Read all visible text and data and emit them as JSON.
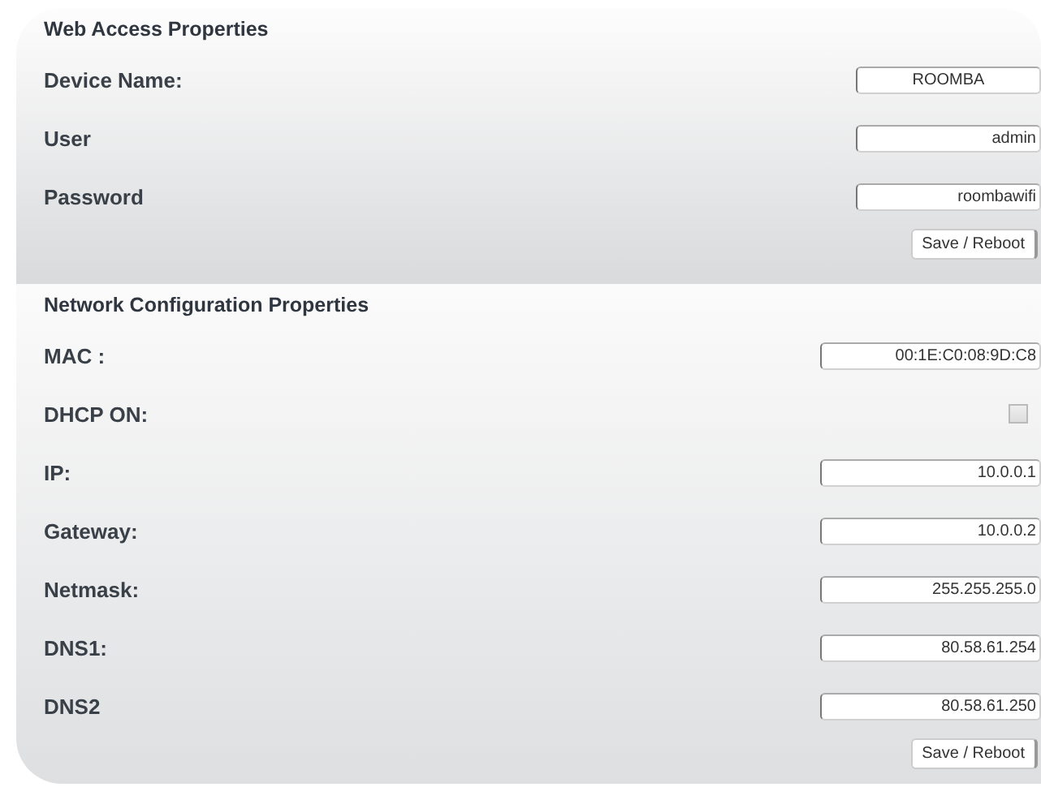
{
  "sections": [
    {
      "title": "Web Access Properties",
      "fields": [
        {
          "kind": "text",
          "label": "Device Name:",
          "value": "ROOMBA"
        },
        {
          "kind": "text",
          "label": "User",
          "value": "admin"
        },
        {
          "kind": "text",
          "label": "Password",
          "value": "roombawifi"
        }
      ],
      "button": "Save / Reboot"
    },
    {
      "title": "Network Configuration Properties",
      "fields": [
        {
          "kind": "text",
          "label": "MAC :",
          "value": "00:1E:C0:08:9D:C8"
        },
        {
          "kind": "checkbox",
          "label": "DHCP ON:",
          "checked": false
        },
        {
          "kind": "text",
          "label": "IP:",
          "value": "10.0.0.1"
        },
        {
          "kind": "text",
          "label": "Gateway:",
          "value": "10.0.0.2"
        },
        {
          "kind": "text",
          "label": "Netmask:",
          "value": "255.255.255.0"
        },
        {
          "kind": "text",
          "label": "DNS1:",
          "value": "80.58.61.254"
        },
        {
          "kind": "text",
          "label": "DNS2",
          "value": "80.58.61.250"
        }
      ],
      "button": "Save / Reboot"
    }
  ]
}
